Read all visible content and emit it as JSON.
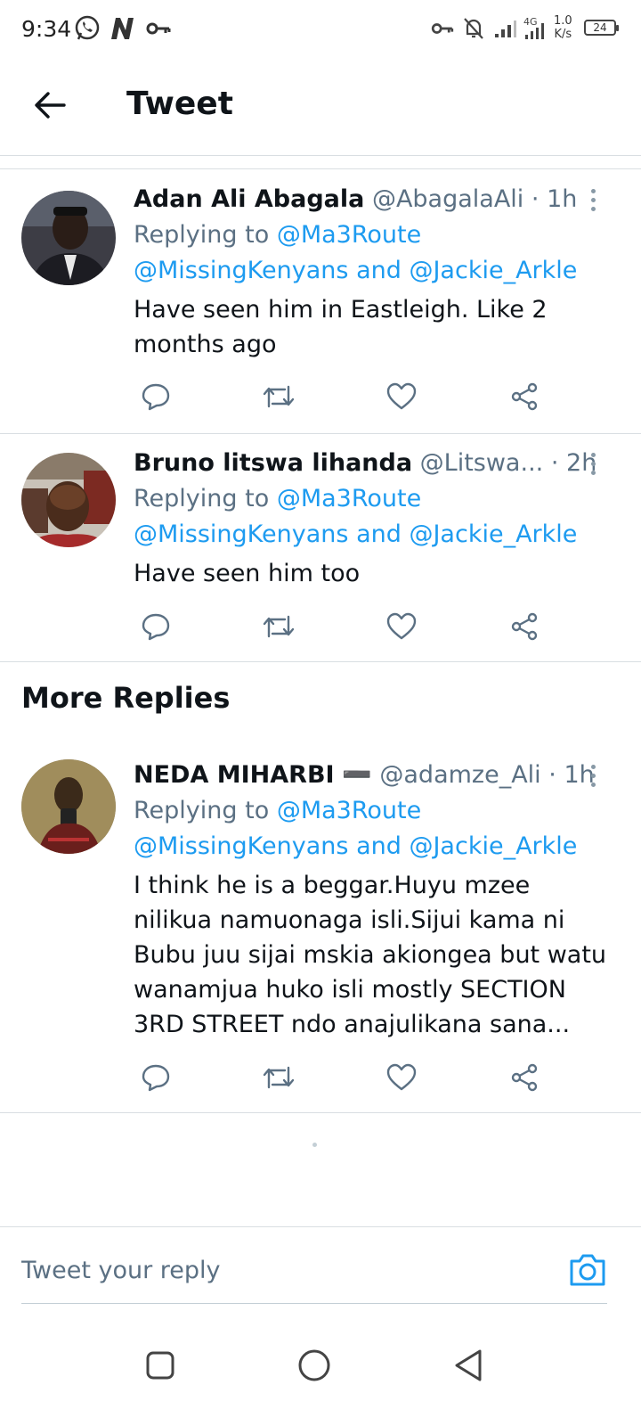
{
  "status_bar": {
    "time": "9:34",
    "network": "4G",
    "speed_value": "1.0",
    "speed_unit": "K/s",
    "battery": "24",
    "icons": [
      "whatsapp-icon",
      "n-icon",
      "key-icon",
      "key-icon",
      "mute-icon",
      "signal-icon",
      "signal-4g-icon"
    ]
  },
  "header": {
    "title": "Tweet"
  },
  "replies": [
    {
      "name": "Adan Ali Abagala",
      "handle": "@AbagalaAli",
      "dot": "·",
      "time": "1h",
      "replying_prefix": "Replying to",
      "mention_1": "@Ma3Route",
      "mention_2": "@MissingKenyans",
      "and": "and",
      "mention_3": "@Jackie_Arkle",
      "text": "Have seen him in Eastleigh. Like 2 months ago"
    },
    {
      "name": "Bruno litswa lihanda",
      "handle": "@Litswa...",
      "dot": "·",
      "time": "2h",
      "replying_prefix": "Replying to",
      "mention_1": "@Ma3Route",
      "mention_2": "@MissingKenyans",
      "and": "and",
      "mention_3": "@Jackie_Arkle",
      "text": "Have seen him too"
    },
    {
      "name": "NEDA MIHARBI",
      "name_suffix": "➖",
      "handle": "@adamze_Ali",
      "dot": "·",
      "time": "1h",
      "replying_prefix": "Replying to",
      "mention_1": "@Ma3Route",
      "mention_2": "@MissingKenyans",
      "and": "and",
      "mention_3": "@Jackie_Arkle",
      "text": "I think he is a beggar.Huyu mzee nilikua namuonaga isli.Sijui kama ni Bubu juu sijai mskia akiongea but watu wanamjua huko isli mostly SECTION 3RD STREET ndo anajulikana sana..."
    }
  ],
  "more_replies_heading": "More Replies",
  "composer": {
    "placeholder": "Tweet your reply"
  },
  "colors": {
    "accent": "#1d9bf0",
    "muted": "#5b7083",
    "text": "#0f1419",
    "divider": "#d9dee2"
  }
}
